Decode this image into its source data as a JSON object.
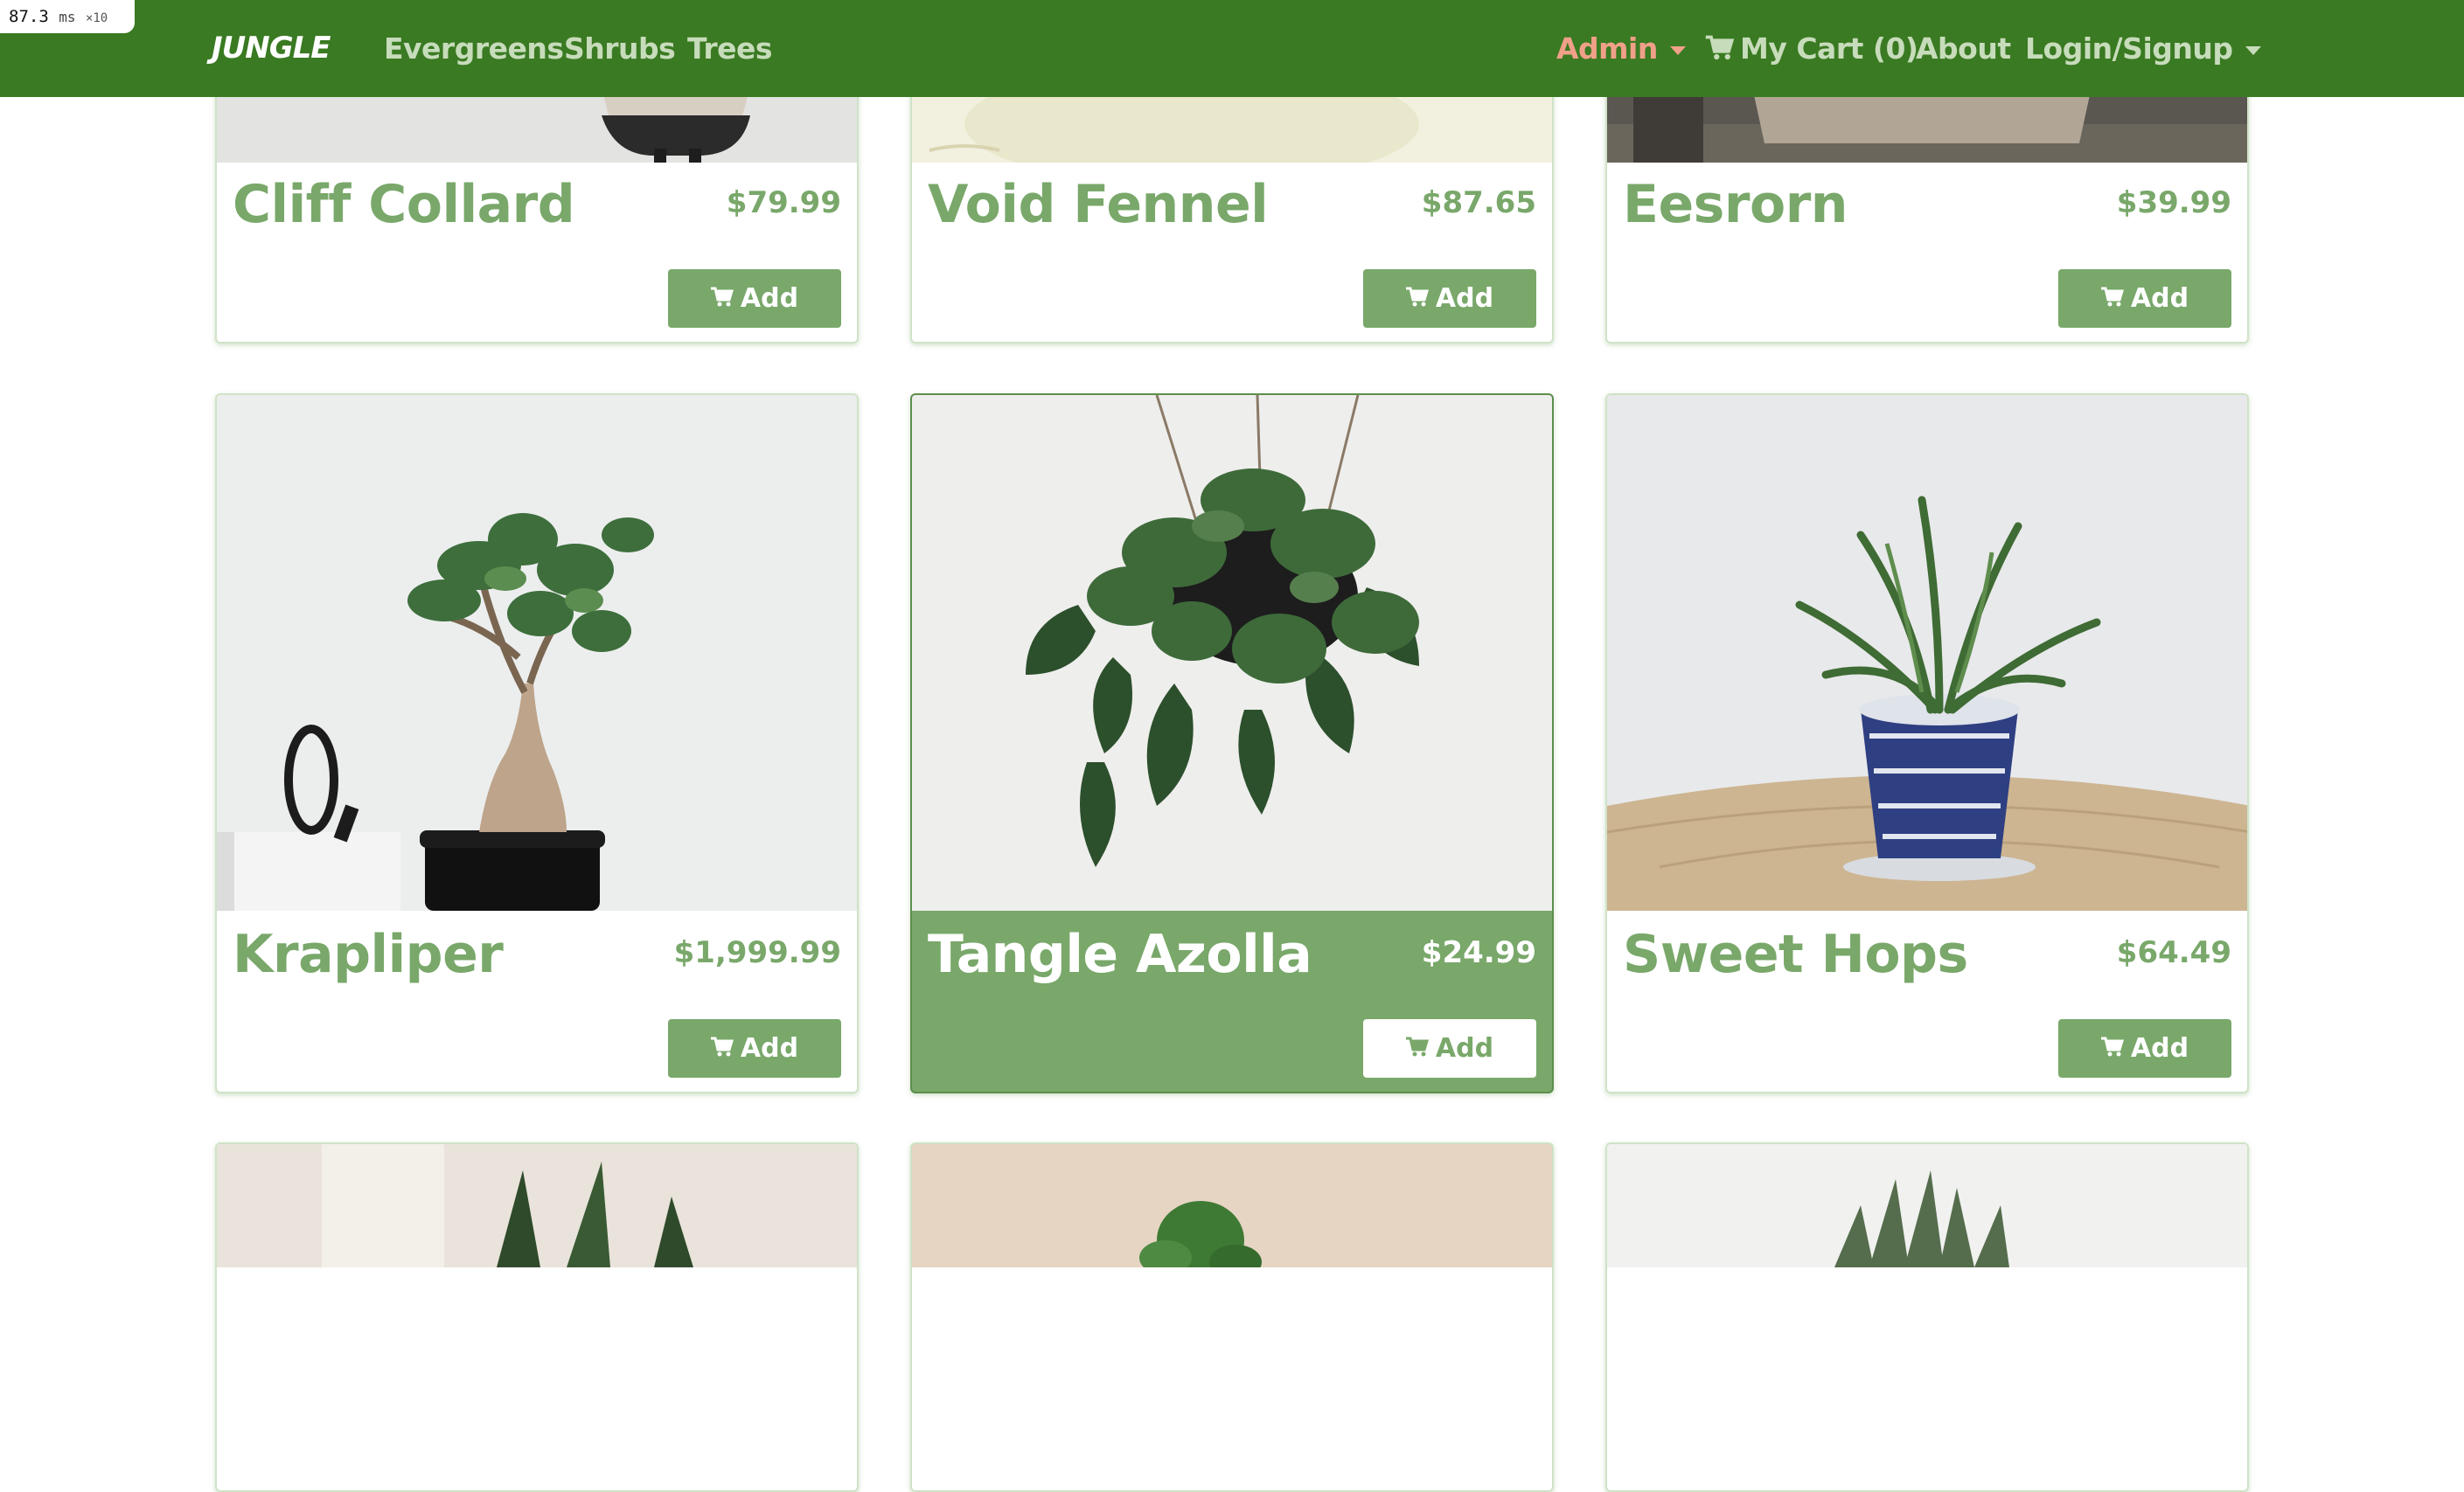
{
  "debug": {
    "time": "87.3",
    "unit": "ms",
    "multiplier": "×10"
  },
  "navbar": {
    "brand": "JUNGLE",
    "links": [
      "Evergreens",
      "Shrubs",
      "Trees"
    ],
    "admin": "Admin",
    "cart": "My Cart (0)",
    "about": "About",
    "login": "Login/Signup",
    "colors": {
      "bar": "#3a7a22",
      "link": "#c7dcbb",
      "admin": "#f0a089"
    }
  },
  "add_label": "Add",
  "products": [
    {
      "name": "Cliff Collard",
      "price": "$79.99"
    },
    {
      "name": "Void Fennel",
      "price": "$87.65"
    },
    {
      "name": "Eesrorn",
      "price": "$39.99"
    },
    {
      "name": "Krapliper",
      "price": "$1,999.99"
    },
    {
      "name": "Tangle Azolla",
      "price": "$24.99"
    },
    {
      "name": "Sweet Hops",
      "price": "$64.49"
    }
  ],
  "colors": {
    "accent": "#79a86a",
    "card_border": "#cfe3c7"
  }
}
